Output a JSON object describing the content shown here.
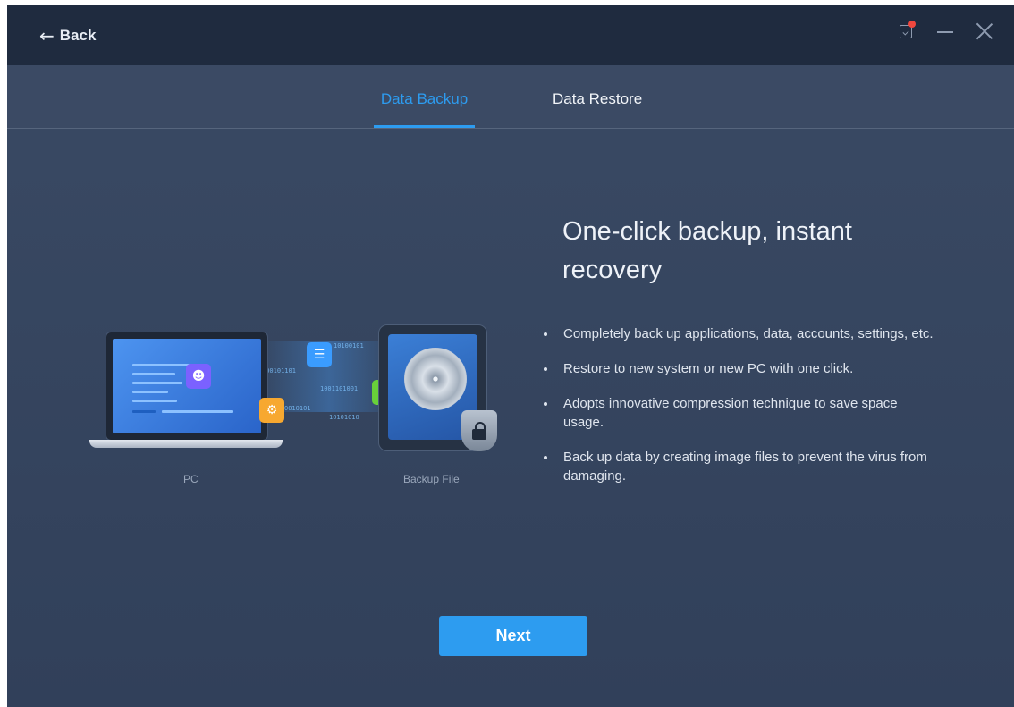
{
  "titlebar": {
    "back_label": "Back",
    "icons": [
      "back-arrow-icon",
      "message-icon",
      "minimize-icon",
      "close-icon"
    ],
    "notification_dot_color": "#f0473e"
  },
  "tabs": [
    {
      "label": "Data Backup",
      "active": true
    },
    {
      "label": "Data Restore",
      "active": false
    }
  ],
  "illustration": {
    "source_label": "PC",
    "target_label": "Backup File",
    "bit_strings": [
      "10100101",
      "100101101",
      "1001101001",
      "0010101",
      "10101010"
    ]
  },
  "content": {
    "headline": "One-click backup, instant recovery",
    "features": [
      "Completely back up applications, data, accounts, settings, etc.",
      "Restore to new system or new PC with one click.",
      "Adopts innovative compression technique to save space usage.",
      "Back up data by creating image files to prevent the virus from damaging."
    ]
  },
  "actions": {
    "next_label": "Next"
  },
  "colors": {
    "accent": "#2d9cf0",
    "titlebar": "#1f2b3f",
    "background": "#36455f"
  }
}
